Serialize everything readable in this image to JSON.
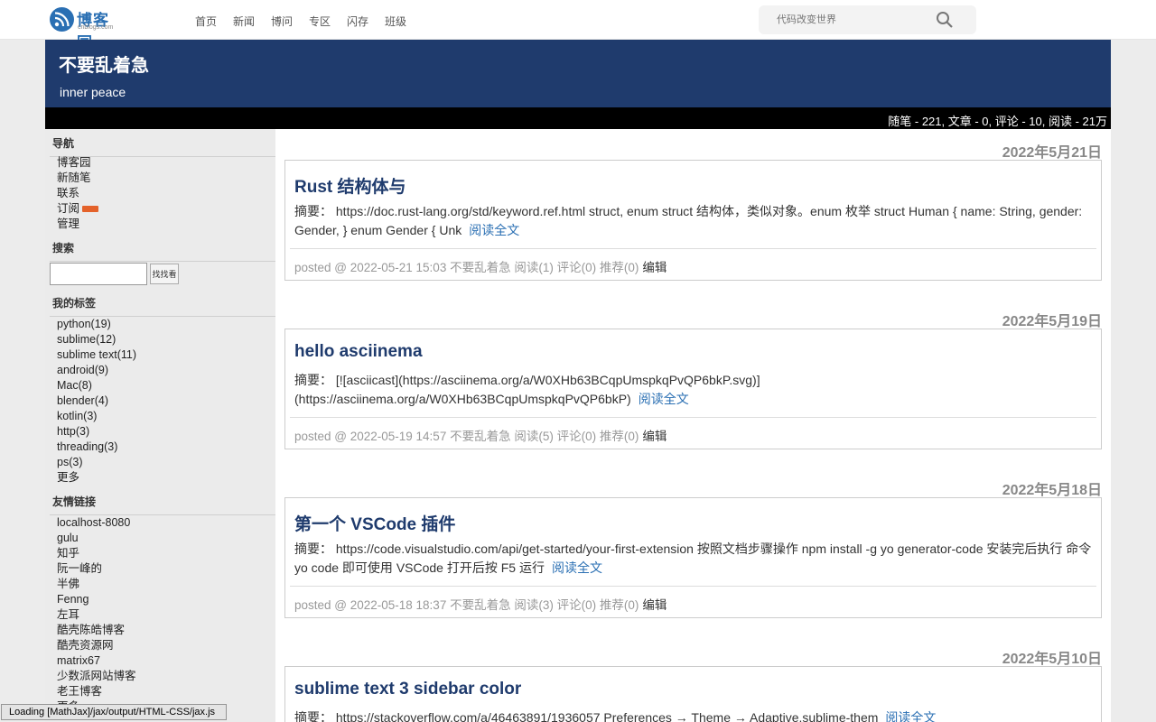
{
  "topnav": {
    "logo_text": "博客园",
    "logo_sub": "cnblogs.com",
    "links": [
      "首页",
      "新闻",
      "博问",
      "专区",
      "闪存",
      "班级"
    ],
    "search_placeholder": "代码改变世界"
  },
  "header": {
    "title": "不要乱着急",
    "subtitle": "inner peace",
    "stats": "随笔 - 221, 文章 - 0, 评论 - 10, 阅读 - 21万"
  },
  "sidebar": {
    "nav_heading": "导航",
    "nav_items": [
      "博客园",
      "新随笔",
      "联系",
      "订阅",
      "管理"
    ],
    "search_heading": "搜索",
    "search_button": "找找看",
    "tags_heading": "我的标签",
    "tags": [
      "python(19)",
      "sublime(12)",
      "sublime text(11)",
      "android(9)",
      "Mac(8)",
      "blender(4)",
      "kotlin(3)",
      "http(3)",
      "threading(3)",
      "ps(3)",
      "更多"
    ],
    "links_heading": "友情链接",
    "links": [
      "localhost-8080",
      "gulu",
      "知乎",
      "阮一峰的",
      "半佛",
      "Fenng",
      "左耳",
      "酷壳陈皓博客",
      "酷壳资源网",
      "matrix67",
      "少数派网站博客",
      "老王博客",
      "更多"
    ]
  },
  "posts": [
    {
      "date": "2022年5月21日",
      "title": "Rust 结构体与",
      "summary": "摘要： https://doc.rust-lang.org/std/keyword.ref.html struct, enum struct 结构体，类似对象。enum 枚举 struct Human { name: String, gender: Gender, } enum Gender { Unk",
      "readmore": "阅读全文",
      "footer": "posted @ 2022-05-21 15:03 不要乱着急 阅读(1) 评论(0) 推荐(0)",
      "edit": "编辑"
    },
    {
      "date": "2022年5月19日",
      "title": "hello asciinema",
      "summary": "摘要： [![asciicast](https://asciinema.org/a/W0XHb63BCqpUmspkqPvQP6bkP.svg)](https://asciinema.org/a/W0XHb63BCqpUmspkqPvQP6bkP)",
      "readmore": "阅读全文",
      "footer": "posted @ 2022-05-19 14:57 不要乱着急 阅读(5) 评论(0) 推荐(0)",
      "edit": "编辑"
    },
    {
      "date": "2022年5月18日",
      "title": "第一个 VSCode 插件",
      "summary": "摘要： https://code.visualstudio.com/api/get-started/your-first-extension 按照文档步骤操作 npm install -g yo generator-code 安装完后执行 命令 yo code 即可使用 VSCode 打开后按 F5 运行",
      "readmore": "阅读全文",
      "footer": "posted @ 2022-05-18 18:37 不要乱着急 阅读(3) 评论(0) 推荐(0)",
      "edit": "编辑"
    },
    {
      "date": "2022年5月10日",
      "title": "sublime text 3 sidebar color",
      "summary": "摘要： https://stackoverflow.com/a/46463891/1936057 Preferences → Theme → Adaptive.sublime-them",
      "readmore": "阅读全文",
      "footer": "",
      "edit": ""
    }
  ],
  "status": {
    "mathjax": "Loading [MathJax]/jax/output/HTML-CSS/jax.js"
  },
  "colors": {
    "banner": "#1f3b6d",
    "statbar": "#000000",
    "accent": "#2a6fb3"
  }
}
